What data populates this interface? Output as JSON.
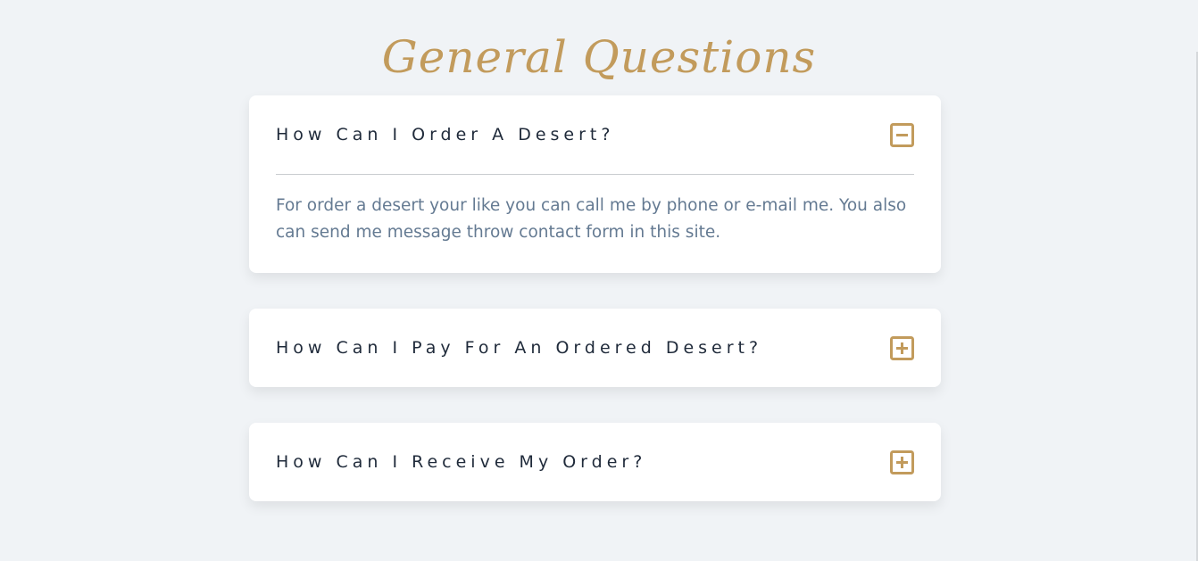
{
  "page": {
    "title": "General Questions"
  },
  "colors": {
    "background": "#f0f3f6",
    "accent": "#c29b5c",
    "question_text": "#1f2a3a",
    "answer_text": "#647a92",
    "card": "#ffffff"
  },
  "faq": [
    {
      "question": "How Can I Order A Desert?",
      "answer": "For order a desert your like you can call me by phone or e-mail me. You also can send me message throw contact form in this site.",
      "expanded": true,
      "toggle_icon": "minus-square-icon"
    },
    {
      "question": "How Can I Pay For An Ordered Desert?",
      "expanded": false,
      "toggle_icon": "plus-square-icon"
    },
    {
      "question": "How Can I Receive My Order?",
      "expanded": false,
      "toggle_icon": "plus-square-icon"
    }
  ]
}
